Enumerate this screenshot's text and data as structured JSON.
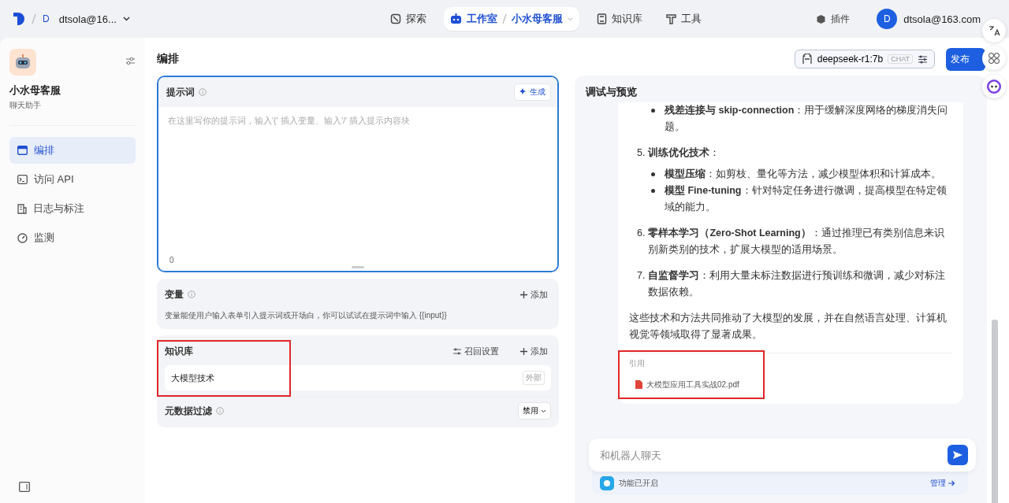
{
  "topbar": {
    "workspace": {
      "initial": "D",
      "name": "dtsola@16..."
    },
    "nav": [
      {
        "kind": "explore",
        "label": "探索",
        "selected": false
      },
      {
        "kind": "studio",
        "label": "工作室",
        "app": "小水母客服",
        "selected": true
      },
      {
        "kind": "knowledge",
        "label": "知识库",
        "selected": false
      },
      {
        "kind": "tools",
        "label": "工具",
        "selected": false
      }
    ],
    "plugins": "插件",
    "user": {
      "initial": "D",
      "email": "dtsola@163.com"
    }
  },
  "sidebar": {
    "app_name": "小水母客服",
    "app_type": "聊天助手",
    "items": [
      {
        "kind": "layout",
        "label": "编排",
        "selected": true
      },
      {
        "kind": "api",
        "label": "访问 API",
        "selected": false
      },
      {
        "kind": "logs",
        "label": "日志与标注",
        "selected": false
      },
      {
        "kind": "monitor",
        "label": "监测",
        "selected": false
      }
    ]
  },
  "editor": {
    "title": "编排",
    "model": {
      "name": "deepseek-r1:7b",
      "mode": "CHAT"
    },
    "publish": "发布",
    "prompt": {
      "title": "提示词",
      "generate": "生成",
      "placeholder": "在这里写你的提示词，输入'{' 插入变量、输入'/' 插入提示内容块",
      "count": "0"
    },
    "variables": {
      "title": "变量",
      "add": "添加",
      "hint": "变量能使用户输入表单引入提示词或开场白，你可以试试在提示词中输入 {{input}}"
    },
    "knowledge": {
      "title": "知识库",
      "recall": "召回设置",
      "add": "添加",
      "annotated": true,
      "items": [
        {
          "name": "大模型技术",
          "tag": "外部"
        }
      ],
      "metadata_filter": {
        "label": "元数据过滤",
        "value": "禁用"
      }
    }
  },
  "preview": {
    "title": "调试与预览",
    "message": [
      {
        "kind": "bullet",
        "text": "**残差连接与 skip-connection**：用于缓解深度网络的梯度消失问题。"
      },
      {
        "kind": "numbered",
        "num": "5.",
        "text": "**训练优化技术**：",
        "children": [
          {
            "kind": "bullet",
            "text": "**模型压缩**：如剪枝、量化等方法，减少模型体积和计算成本。"
          },
          {
            "kind": "bullet",
            "text": "**模型 Fine-tuning**：针对特定任务进行微调，提高模型在特定领域的能力。"
          }
        ]
      },
      {
        "kind": "numbered",
        "num": "6.",
        "text": "**零样本学习（Zero-Shot Learning）**：通过推理已有类别信息来识别新类别的技术，扩展大模型的适用场景。"
      },
      {
        "kind": "numbered",
        "num": "7.",
        "text": "**自监督学习**：利用大量未标注数据进行预训练和微调，减少对标注数据依赖。"
      },
      {
        "kind": "para",
        "text": "这些技术和方法共同推动了大模型的发展，并在自然语言处理、计算机视觉等领域取得了显著成果。"
      }
    ],
    "citation": {
      "label": "引用",
      "file": "大模型应用工具实战02.pdf",
      "annotated": true
    },
    "input": {
      "placeholder": "和机器人聊天"
    },
    "features": {
      "status": "功能已开启",
      "manage": "管理"
    }
  }
}
